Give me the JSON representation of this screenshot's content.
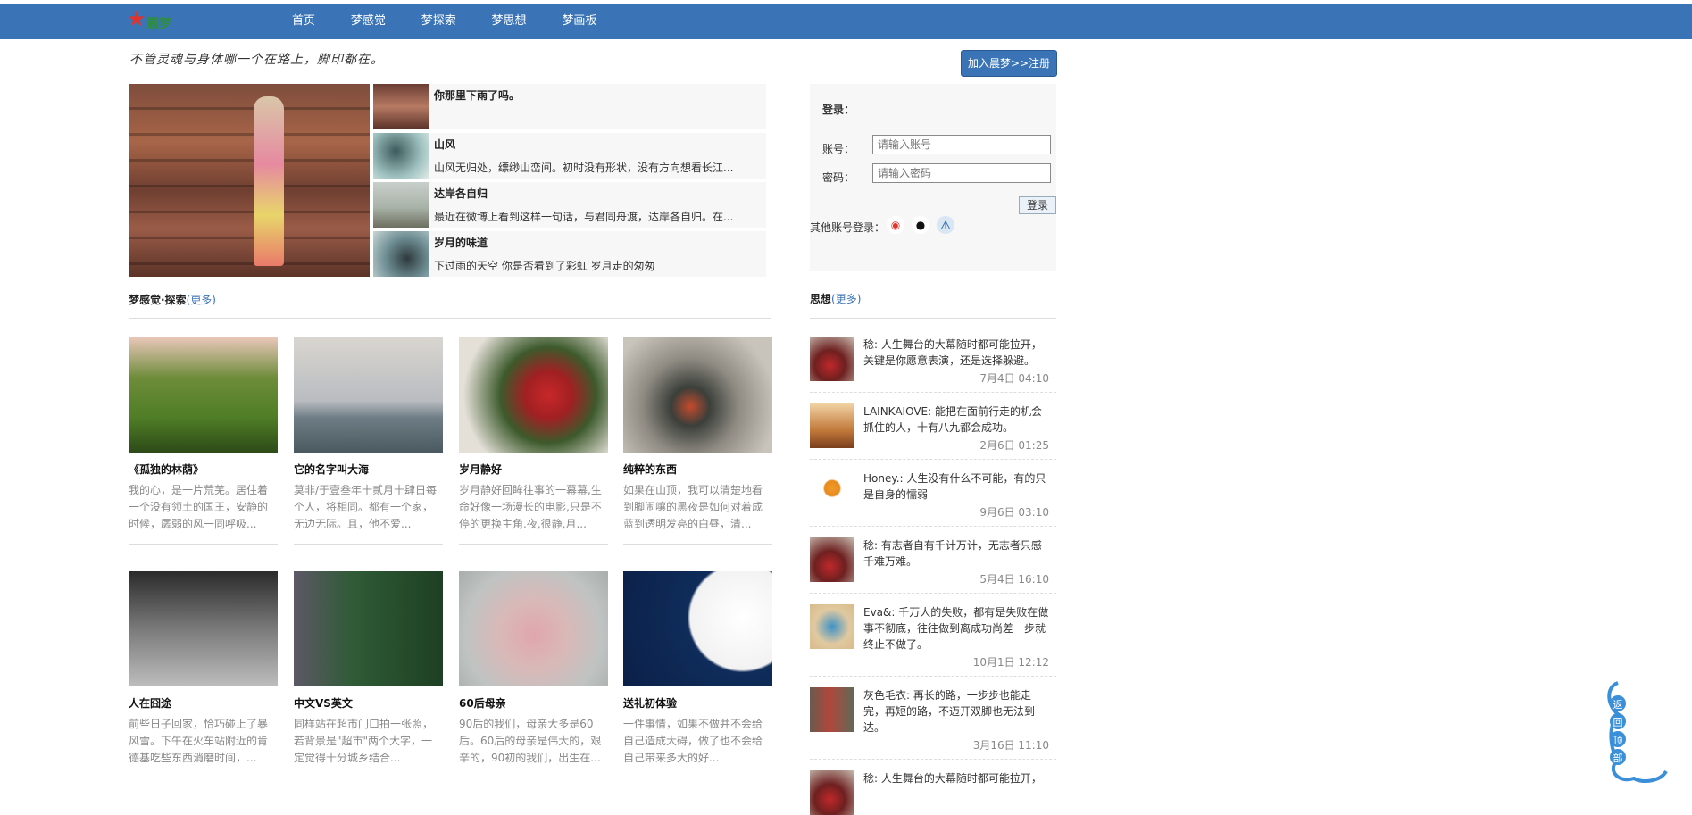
{
  "header": {
    "logo_text": "晨梦",
    "nav": [
      "首页",
      "梦感觉",
      "梦探索",
      "梦思想",
      "梦画板"
    ]
  },
  "slogan": "不管灵魂与身体哪一个在路上，脚印都在。",
  "join_button": "加入晨梦>>注册",
  "featured": [
    {
      "title": "你那里下雨了吗。",
      "desc": ""
    },
    {
      "title": "山风",
      "desc": "山风无归处，缥缈山峦间。初时没有形状，没有方向想看长江..."
    },
    {
      "title": "达岸各自归",
      "desc": "最近在微博上看到这样一句话，与君同舟渡，达岸各自归。在..."
    },
    {
      "title": "岁月的味道",
      "desc": "下过雨的天空 你是否看到了彩虹 岁月走的匆匆"
    }
  ],
  "login": {
    "title": "登录：",
    "account_label": "账号：",
    "account_placeholder": "请输入账号",
    "password_label": "密码：",
    "password_placeholder": "请输入密码",
    "submit": "登录",
    "other_label": "其他账号登录："
  },
  "section_explore": {
    "title": "梦感觉·探索",
    "more": "(更多)"
  },
  "section_thought": {
    "title": "思想",
    "more": "(更多)"
  },
  "cards": [
    {
      "title": "《孤独的林荫》",
      "desc": "我的心，是一片荒芜。居住着一个没有领土的国王，安静的时候，孱弱的风一同呼吸..."
    },
    {
      "title": "它的名字叫大海",
      "desc": "莫非/于壹叁年十贰月十肆日每个人，将相同。都有一个家，无边无际。且，他不爱..."
    },
    {
      "title": "岁月静好",
      "desc": "岁月静好回眸往事的一幕幕,生命好像一场漫长的电影,只是不停的更换主角.夜,很静,月..."
    },
    {
      "title": "纯粹的东西",
      "desc": "如果在山顶，我可以清楚地看到脚闹嚷的黑夜是如何对着成蓝到透明发亮的白昼，清..."
    },
    {
      "title": "人在囧途",
      "desc": "前些日子回家，恰巧碰上了暴风雪。下午在火车站附近的肯德基吃些东西消磨时间，..."
    },
    {
      "title": "中文VS英文",
      "desc": "同样站在超市门口拍一张照，若背景是\"超市\"两个大字，一定觉得十分城乡结合..."
    },
    {
      "title": "60后母亲",
      "desc": "90后的我们，母亲大多是60后。60后的母亲是伟大的，艰辛的，90初的我们，出生在..."
    },
    {
      "title": "送礼初体验",
      "desc": "一件事情，如果不做并不会给自己造成大碍，做了也不会给自己带来多大的好..."
    }
  ],
  "thoughts": [
    {
      "msg": "稔: 人生舞台的大幕随时都可能拉开，关键是你愿意表演，还是选择躲避。",
      "time": "7月4日 04:10"
    },
    {
      "msg": "LAINKAIOVE: 能把在面前行走的机会抓住的人，十有八九都会成功。",
      "time": "2月6日 01:25"
    },
    {
      "msg": "Honey.: 人生没有什么不可能，有的只是自身的懦弱",
      "time": "9月6日 03:10"
    },
    {
      "msg": "稔: 有志者自有千计万计，无志者只感千难万难。",
      "time": "5月4日 16:10"
    },
    {
      "msg": "Eva&: 千万人的失败，都有是失败在做事不彻底，往往做到离成功尚差一步就终止不做了。",
      "time": "10月1日 12:12"
    },
    {
      "msg": "灰色毛衣: 再长的路，一步步也能走完，再短的路，不迈开双脚也无法到达。",
      "time": "3月16日 11:10"
    },
    {
      "msg": "稔: 人生舞台的大幕随时都可能拉开，",
      "time": ""
    }
  ],
  "back_to_top": "返回顶部"
}
